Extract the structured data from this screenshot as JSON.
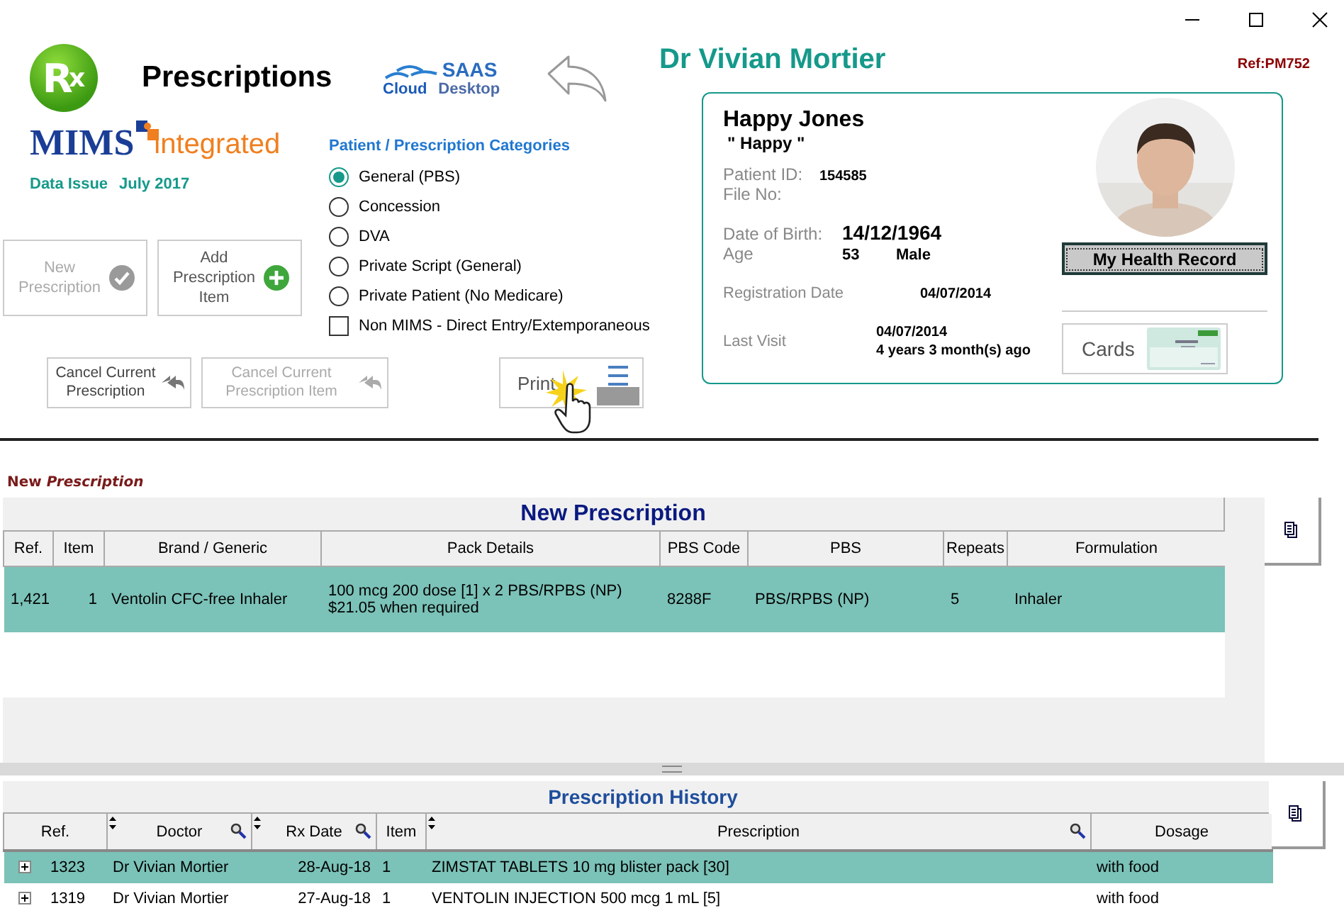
{
  "title": "Prescriptions",
  "rx_logo": {
    "letter": "R",
    "subscript": "x"
  },
  "saas_logo": {
    "top": "SAAS",
    "left": "Cloud",
    "right": "Desktop"
  },
  "mims_logo": {
    "brand": "MIMS",
    "suffix": "integrated"
  },
  "data_issue": {
    "label": "Data Issue",
    "value": "July 2017"
  },
  "actions": [
    {
      "label": "New Prescription",
      "disabled": true
    },
    {
      "label": "Add Prescription Item",
      "disabled": false
    }
  ],
  "cancel_actions": [
    {
      "label": "Cancel Current Prescription",
      "disabled": false
    },
    {
      "label": "Cancel Current Prescription Item",
      "disabled": true
    }
  ],
  "categories": {
    "title": "Patient / Prescription Categories",
    "options": [
      {
        "label": "General (PBS)",
        "selected": true
      },
      {
        "label": "Concession",
        "selected": false
      },
      {
        "label": "DVA",
        "selected": false
      },
      {
        "label": "Private Script (General)",
        "selected": false
      },
      {
        "label": "Private Patient (No Medicare)",
        "selected": false
      }
    ],
    "non_mims": {
      "label": "Non MIMS - Direct Entry/Extemporaneous",
      "checked": false
    }
  },
  "print_button": {
    "label": "Print"
  },
  "doctor": "Dr Vivian Mortier",
  "ref": "Ref:PM752",
  "patient": {
    "name": "Happy Jones",
    "nickname": "\" Happy \"",
    "patient_id": {
      "label": "Patient ID:",
      "value": "154585"
    },
    "file_no": {
      "label": "File No:"
    },
    "dob": {
      "label": "Date of Birth:",
      "value": "14/12/1964"
    },
    "age": {
      "label": "Age",
      "value": "53",
      "sex": "Male"
    },
    "registration": {
      "label": "Registration Date",
      "value": "04/07/2014"
    },
    "last_visit": {
      "label": "Last Visit",
      "date": "04/07/2014",
      "ago": "4 years 3 month(s) ago"
    },
    "health_record_button": "My Health Record",
    "cards_button": "Cards"
  },
  "current_label": "New *Prescription*",
  "new_prescription": {
    "title": "New Prescription",
    "columns": [
      "Ref.",
      "Item",
      "Brand / Generic",
      "Pack Details",
      "PBS Code",
      "PBS",
      "Repeats",
      "Formulation"
    ],
    "rows": [
      {
        "selected": true,
        "cells": [
          "1,421",
          "1",
          "Ventolin CFC-free Inhaler",
          "100 mcg 200 dose [1] x 2 PBS/RPBS (NP) $21.05 when required",
          "8288F",
          "PBS/RPBS (NP)",
          "5",
          "Inhaler"
        ]
      }
    ]
  },
  "history": {
    "title": "Prescription History",
    "columns": [
      {
        "label": "Ref.",
        "filterable": false
      },
      {
        "label": "Doctor",
        "filterable": true
      },
      {
        "label": "Rx Date",
        "filterable": true
      },
      {
        "label": "Item",
        "filterable": false
      },
      {
        "label": "Prescription",
        "filterable": true
      },
      {
        "label": "Dosage",
        "filterable": false
      }
    ],
    "rows": [
      {
        "selected": true,
        "expanded": false,
        "cells": [
          "1323",
          "Dr Vivian Mortier",
          "28-Aug-18",
          "1",
          "ZIMSTAT TABLETS 10 mg blister pack [30]",
          "with food"
        ]
      },
      {
        "selected": false,
        "expanded": false,
        "cells": [
          "1319",
          "Dr Vivian Mortier",
          "27-Aug-18",
          "1",
          "VENTOLIN INJECTION 500 mcg 1 mL [5]",
          "with food"
        ]
      }
    ]
  }
}
